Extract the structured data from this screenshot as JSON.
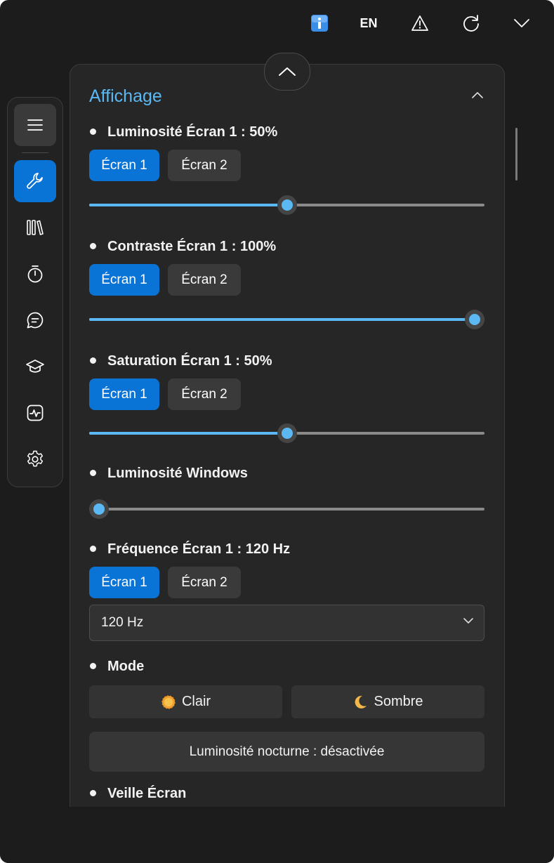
{
  "topbar": {
    "info_icon": "info-icon",
    "language": "EN",
    "warning_icon": "warning-icon",
    "refresh_icon": "refresh-icon",
    "chevron_icon": "chevron-down-icon"
  },
  "sidebar": {
    "items": [
      {
        "icon": "menu-icon"
      },
      {
        "icon": "wrench-icon",
        "active": true
      },
      {
        "icon": "library-icon"
      },
      {
        "icon": "stopwatch-icon"
      },
      {
        "icon": "chat-icon"
      },
      {
        "icon": "graduation-cap-icon"
      },
      {
        "icon": "activity-icon"
      },
      {
        "icon": "gear-icon"
      }
    ]
  },
  "section": {
    "title": "Affichage"
  },
  "settings": {
    "brightness": {
      "label": "Luminosité Écran 1 : 50%",
      "screen1": "Écran 1",
      "screen2": "Écran 2",
      "value_pct": 50
    },
    "contrast": {
      "label": "Contraste Écran 1 : 100%",
      "screen1": "Écran 1",
      "screen2": "Écran 2",
      "value_pct": 100
    },
    "saturation": {
      "label": "Saturation Écran 1 : 50%",
      "screen1": "Écran 1",
      "screen2": "Écran 2",
      "value_pct": 50
    },
    "windows_brightness": {
      "label": "Luminosité Windows",
      "value_pct": 0
    },
    "frequency": {
      "label": "Fréquence Écran 1 : 120 Hz",
      "screen1": "Écran 1",
      "screen2": "Écran 2",
      "selected": "120 Hz"
    },
    "mode": {
      "label": "Mode",
      "light": "Clair",
      "dark": "Sombre"
    },
    "night_light": {
      "label": "Luminosité nocturne : désactivée"
    },
    "screen_sleep": {
      "label": "Veille Écran"
    }
  },
  "colors": {
    "accent": "#0a74d6",
    "slider": "#5cb8f2",
    "title": "#5cb8f2",
    "background": "#1c1c1c",
    "panel": "#262626"
  }
}
